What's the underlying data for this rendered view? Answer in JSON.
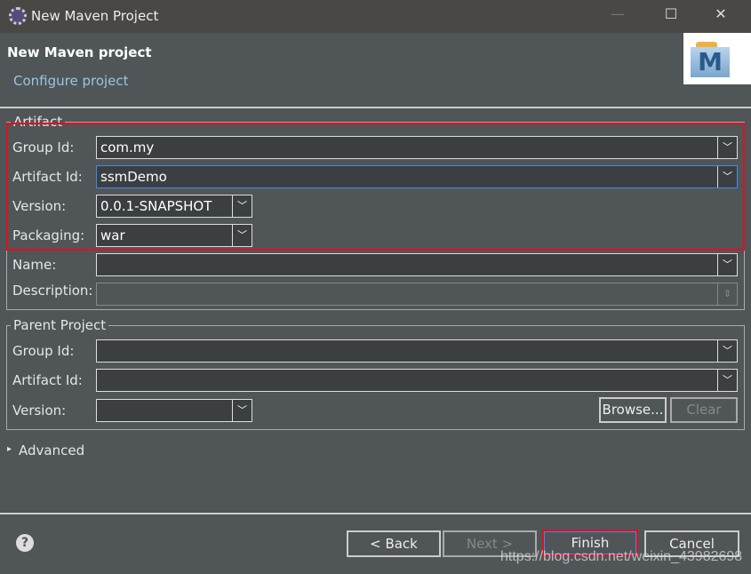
{
  "window": {
    "title": "New Maven Project",
    "minimize": "—",
    "maximize": "☐",
    "close": "✕"
  },
  "header": {
    "title": "New Maven project",
    "subtitle": "Configure project",
    "logo_letter": "M"
  },
  "artifact": {
    "legend": "Artifact",
    "group_id_label": "Group Id:",
    "group_id": "com.my",
    "artifact_id_label": "Artifact Id:",
    "artifact_id": "ssmDemo",
    "version_label": "Version:",
    "version": "0.0.1-SNAPSHOT",
    "packaging_label": "Packaging:",
    "packaging": "war",
    "name_label": "Name:",
    "name": "",
    "description_label": "Description:",
    "description": ""
  },
  "parent": {
    "legend": "Parent Project",
    "group_id_label": "Group Id:",
    "artifact_id_label": "Artifact Id:",
    "version_label": "Version:",
    "browse": "Browse...",
    "clear": "Clear"
  },
  "advanced": "Advanced",
  "buttons": {
    "help": "?",
    "back": "< Back",
    "next": "Next >",
    "finish": "Finish",
    "cancel": "Cancel"
  },
  "watermark": "https://blog.csdn.net/weixin_43982698",
  "colors": {
    "highlight": "#e01020",
    "link": "#9ac6e0"
  }
}
